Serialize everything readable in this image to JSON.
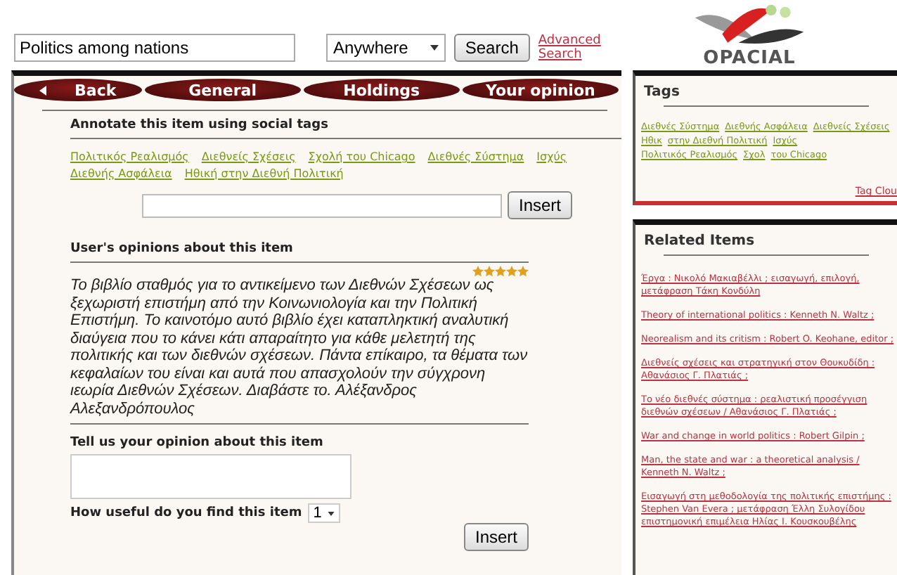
{
  "search": {
    "value": "Politics among nations",
    "scope": "Anywhere",
    "button": "Search",
    "advanced_link": "Advanced Search"
  },
  "logo": {
    "text": "OPACIAL"
  },
  "tabs": [
    {
      "label": "Back",
      "kind": "back"
    },
    {
      "label": "General",
      "kind": "tab"
    },
    {
      "label": "Holdings",
      "kind": "tab"
    },
    {
      "label": "Your opinion",
      "kind": "tab"
    }
  ],
  "annotate": {
    "heading": "Annotate this item using social tags",
    "tags": [
      "Πολιτικός Ρεαλισμός",
      "Διεθνείς Σχέσεις",
      "Σχολή του Chicago",
      "Διεθνές Σύστημα",
      "Ισχύς",
      "Διεθνής Ασφάλεια",
      "Ηθική στην Διεθνή Πολιτική"
    ],
    "insert_button": "Insert"
  },
  "opinions": {
    "heading": "User's opinions about this item",
    "reviews": [
      {
        "stars": 5,
        "text": "Το βιβλίο σταθμός για το αντικείμενο των Διεθνών Σχέσεων ως ξεχωριστή επιστήμη από την Κοινωνιολογία και την Πολιτική Επιστήμη. Το καινοτόμο αυτό βιβλίο έχει καταπληκτική αναλυτική διαύγεια που το κάνει κάτι απαραίτητο για κάθε μελετητή της πολιτικής και των διεθνών σχέσεων. Πάντα επίκαιρο, τα θέματα των κεφαλαίων του είναι και αυτά που απασχολούν την σύγχρονη ιεωρία Διεθνών Σχέσεων. Διαβάστε το. Αλέξανδρος Αλεξανδρόπουλος"
      }
    ]
  },
  "your_opinion": {
    "heading": "Tell us your opinion about this item",
    "usefulness_label": "How useful do you find this item",
    "usefulness_value": "1",
    "insert_button": "Insert"
  },
  "tags_panel": {
    "title": "Tags",
    "tags": [
      "Διεθνές Σύστημα",
      "Διεθνής Ασφάλεια",
      "Διεθνείς Σχέσεις",
      "Ηθικ",
      "στην Διεθνή Πολιτική",
      "Ισχύς",
      "Πολιτικός Ρεαλισμός",
      "Σχολ",
      "του Chicago"
    ],
    "cloud_link": "Tag Clou"
  },
  "related_panel": {
    "title": "Related Items",
    "items": [
      "Έργα : Νικολό Μακιαβέλλι ; εισαγωγή, επιλογή, μετάφραση Τάκη Κονδύλη",
      "Theory of international politics : Kenneth N. Waltz ;",
      "Neorealism and its critism : Robert O. Keohane, editor ;",
      "Διεθνείς σχέσεις και στρατηγική στον Θουκυδίδη : Αθανάσιος Γ. Πλατιάς ;",
      "Το νέο διεθνές σύστημα : ρεαλιστική προσέγγιση διεθνών σχέσεων / Αθανάσιος Γ. Πλατιάς ;",
      "War and change in world politics : Robert Gilpin ;",
      "Man, the state and war : a theoretical analysis / Kenneth N. Waltz ;",
      "Εισαγωγή στη μεθοδολογία της πολιτικής επιστήμης : Stephen Van Evera ; μετάφραση Έλλη Συλογίδου επιστημονική επιμέλεια Ηλίας Ι. Κουσκουβέλης"
    ]
  }
}
